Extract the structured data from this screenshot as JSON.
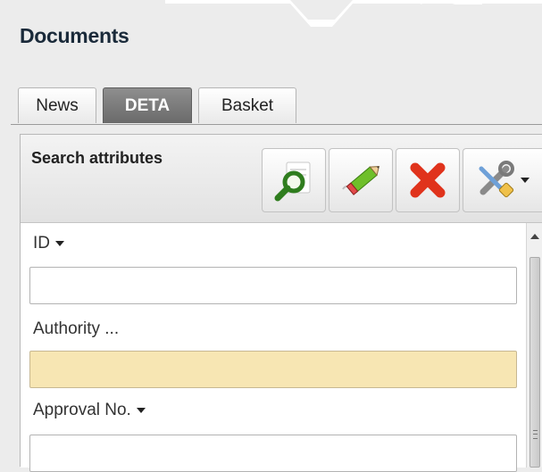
{
  "window": {
    "title": "Documents"
  },
  "tabs": [
    {
      "label": "News",
      "active": false
    },
    {
      "label": "DETA",
      "active": true
    },
    {
      "label": "Basket",
      "active": false
    }
  ],
  "panel": {
    "title": "Search attributes",
    "toolbar": [
      {
        "name": "search-button",
        "icon": "magnifier-icon"
      },
      {
        "name": "edit-button",
        "icon": "pencil-icon"
      },
      {
        "name": "delete-button",
        "icon": "red-x-icon"
      },
      {
        "name": "tools-button",
        "icon": "tools-icon",
        "has_dropdown": true
      }
    ]
  },
  "fields": [
    {
      "label": "ID",
      "has_dropdown": true,
      "value": "",
      "highlighted": false
    },
    {
      "label": "Authority ...",
      "has_dropdown": false,
      "value": "",
      "highlighted": true
    },
    {
      "label": "Approval No.",
      "has_dropdown": true,
      "value": "",
      "highlighted": false
    }
  ],
  "colors": {
    "highlight_field": "#f7e6b3",
    "active_tab": "#7a7a7a",
    "delete_red": "#e0331c"
  }
}
